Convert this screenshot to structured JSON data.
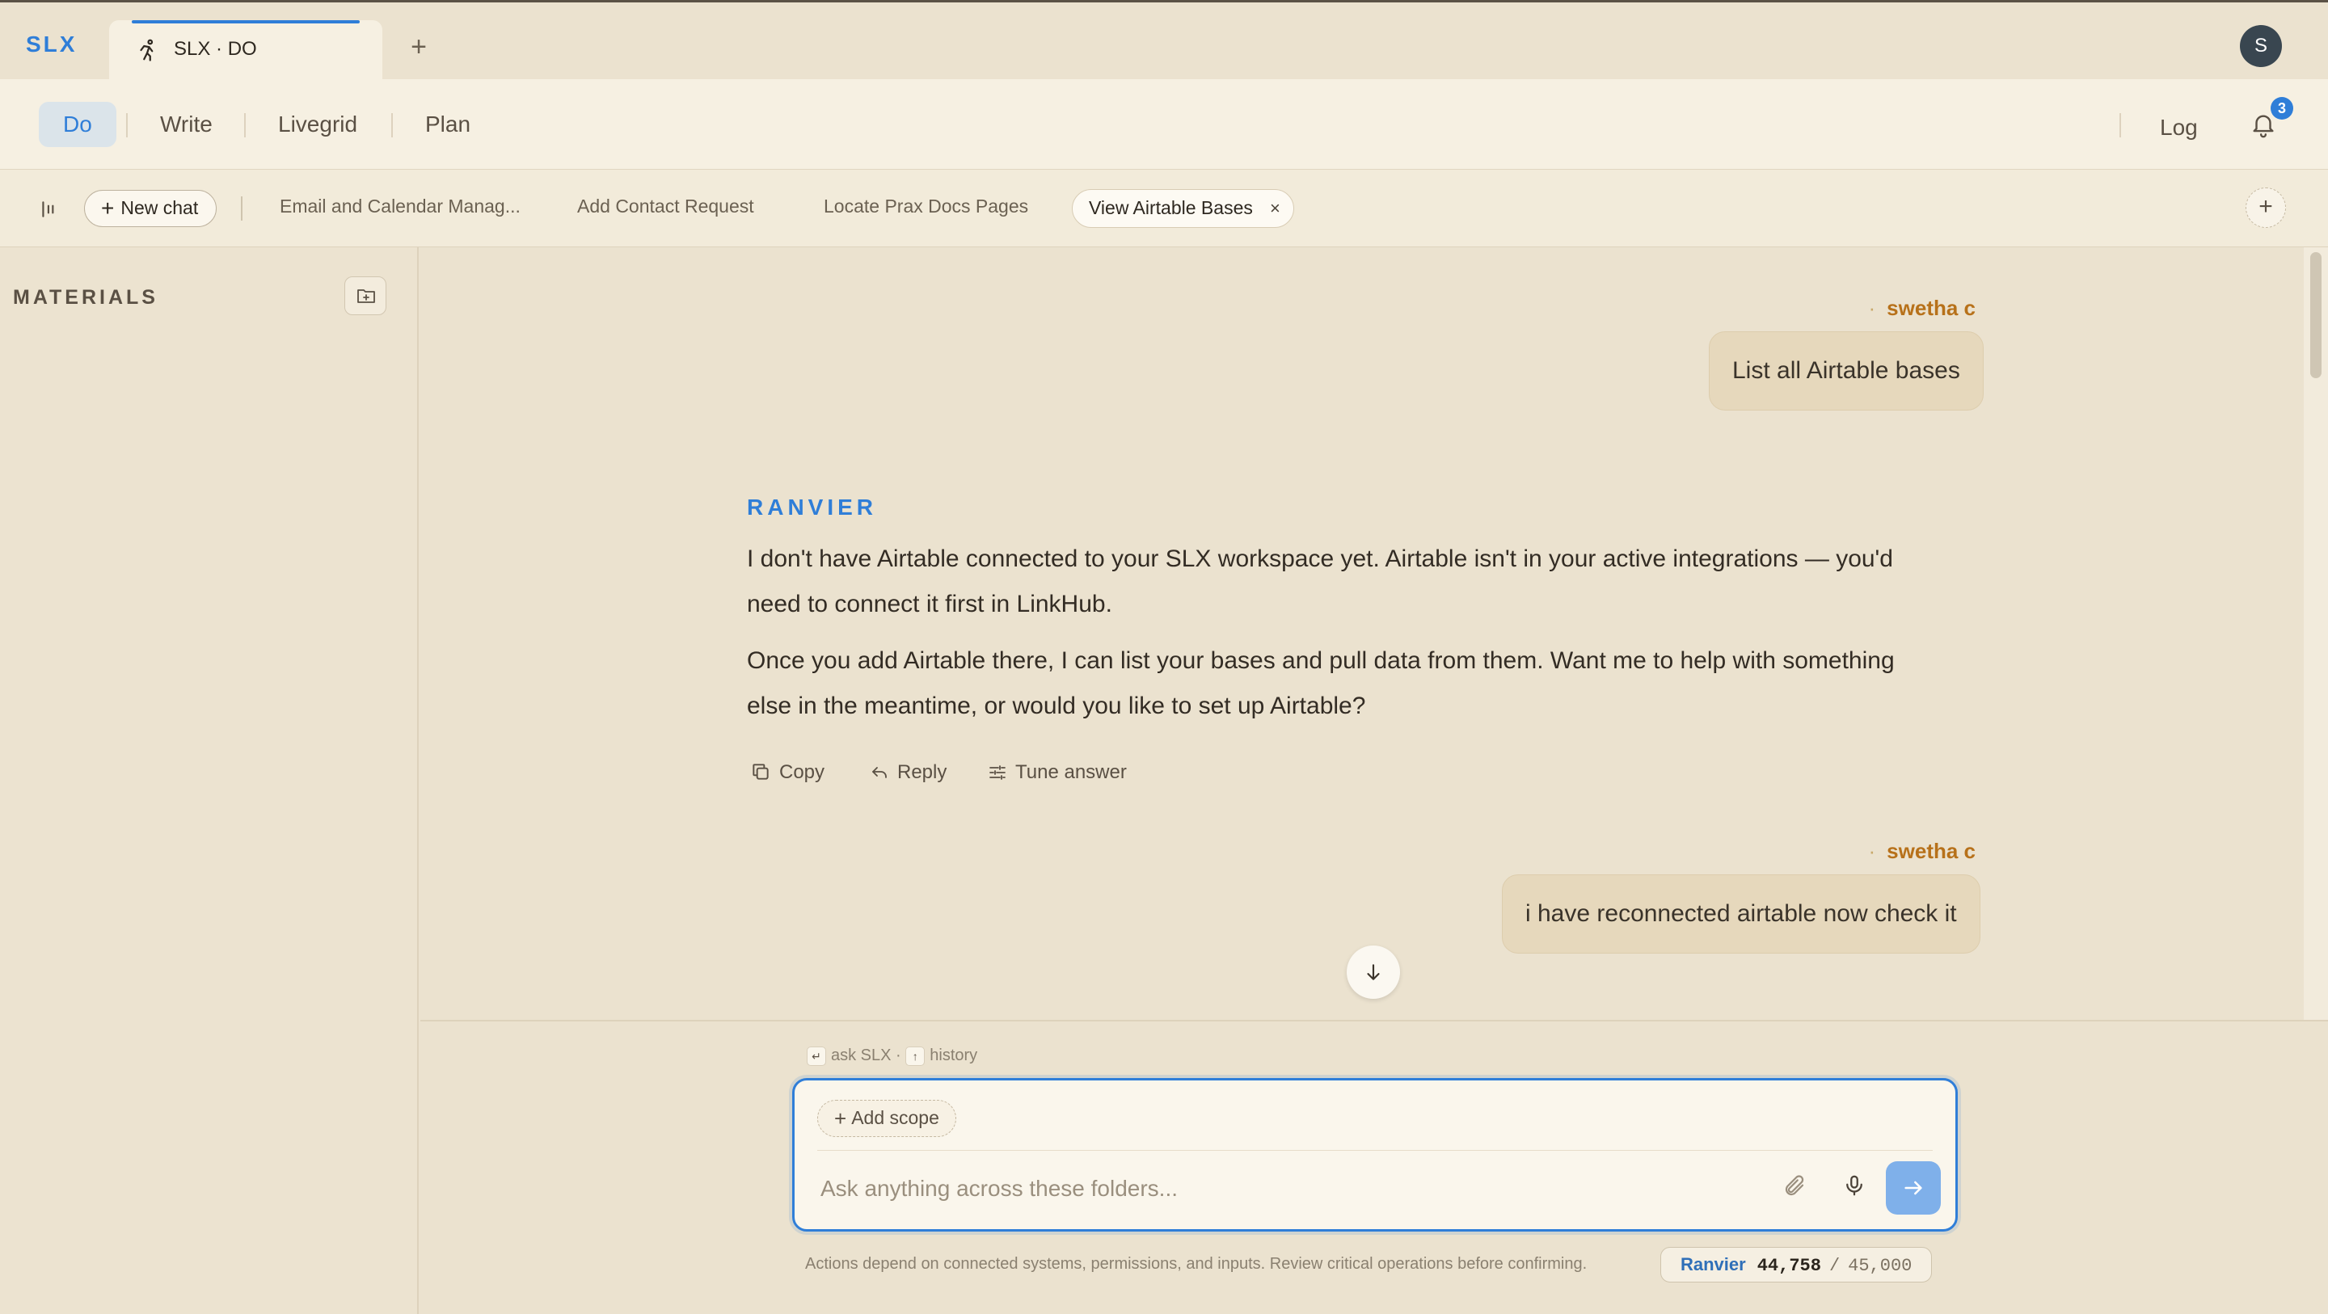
{
  "app": {
    "brand": "SLX",
    "active_tab_label": "SLX · DO",
    "new_tab": "+",
    "avatar_initial": "S"
  },
  "modes": {
    "items": [
      "Do",
      "Write",
      "Livegrid",
      "Plan"
    ],
    "active": "Do",
    "log_label": "Log",
    "notification_count": "3"
  },
  "chatbar": {
    "new_chat_label": "New chat",
    "tabs": [
      "Email and Calendar Manag...",
      "Add Contact Request",
      "Locate Prax Docs Pages"
    ],
    "active_tab": "View Airtable Bases",
    "close_glyph": "×",
    "add_glyph": "+"
  },
  "sidebar": {
    "title": "MATERIALS"
  },
  "conversation": {
    "messages": [
      {
        "role": "user",
        "sender": "swetha c",
        "text": "List all Airtable bases"
      },
      {
        "role": "assistant",
        "sender": "RANVIER",
        "paragraphs": [
          "I don't have Airtable connected to your SLX workspace yet. Airtable isn't in your active integrations — you'd need to connect it first in LinkHub.",
          "Once you add Airtable there, I can list your bases and pull data from them. Want me to help with something else in the meantime, or would you like to set up Airtable?"
        ],
        "actions": [
          "Copy",
          "Reply",
          "Tune answer"
        ]
      },
      {
        "role": "user",
        "sender": "swetha c",
        "text": "i have reconnected airtable now check it"
      }
    ]
  },
  "composer": {
    "hint_ask": "ask SLX ·",
    "hint_history": "history",
    "add_scope_label": "Add scope",
    "placeholder": "Ask anything across these folders...",
    "value": ""
  },
  "footer": {
    "note": "Actions depend on connected systems, permissions, and inputs. Review critical operations before confirming.",
    "usage_name": "Ranvier",
    "usage_used": "44,758",
    "usage_sep": "/",
    "usage_limit": "45,000"
  },
  "colors": {
    "accent": "#2f7ed8",
    "sender": "#b7711a",
    "background": "#ebe2cf",
    "bubble": "#e6d8bc"
  },
  "icons": {
    "tab": "runner-icon",
    "notifications": "bell-icon",
    "sidebar": "sidebar-toggle-icon",
    "folder": "folder-plus-icon",
    "copy": "copy-icon",
    "reply": "reply-icon",
    "tune": "sliders-icon",
    "scroll": "arrow-down-icon",
    "attach": "paperclip-icon",
    "mic": "microphone-icon",
    "send": "arrow-right-icon"
  }
}
